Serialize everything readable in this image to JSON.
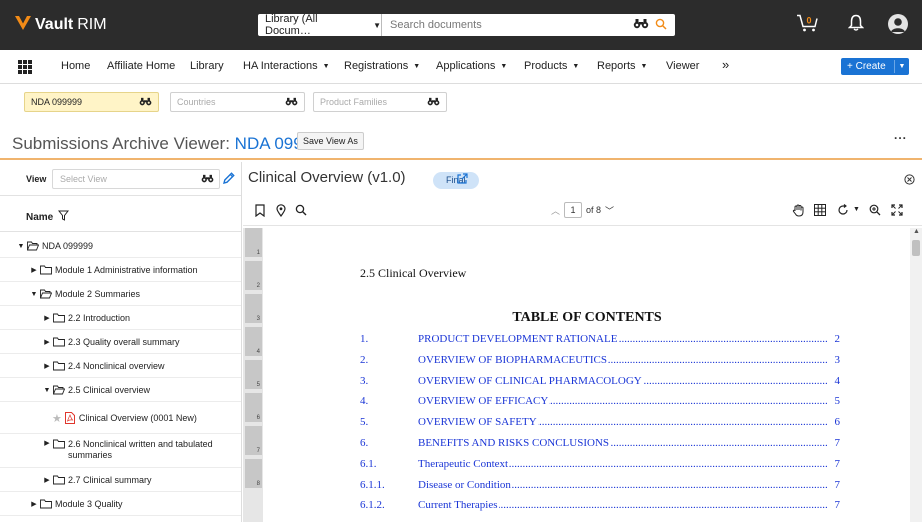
{
  "app": {
    "logo_word": "Vault",
    "logo_suffix": "RIM",
    "brand_color": "#f28b17"
  },
  "search": {
    "scope_label": "Library (All Docum…",
    "placeholder": "Search documents"
  },
  "header_icons": [
    "binoculars-icon",
    "search-icon",
    "cart-icon",
    "bell-icon",
    "avatar"
  ],
  "cart": {
    "count": "0"
  },
  "nav": {
    "items": [
      {
        "label": "Home",
        "dropdown": false
      },
      {
        "label": "Affiliate Home",
        "dropdown": false
      },
      {
        "label": "Library",
        "dropdown": false
      },
      {
        "label": "HA Interactions",
        "dropdown": true
      },
      {
        "label": "Registrations",
        "dropdown": true
      },
      {
        "label": "Applications",
        "dropdown": true
      },
      {
        "label": "Products",
        "dropdown": true
      },
      {
        "label": "Reports",
        "dropdown": true
      },
      {
        "label": "Viewer",
        "dropdown": false
      }
    ],
    "more": "»",
    "create_label": "+ Create"
  },
  "filters": {
    "application": "NDA 099999",
    "countries_placeholder": "Countries",
    "product_families_placeholder": "Product Families"
  },
  "page": {
    "title_prefix": "Submissions Archive Viewer: ",
    "title_link": "NDA 099999",
    "save_view_label": "Save View As",
    "more": "..."
  },
  "left_panel": {
    "view_label": "View",
    "view_placeholder": "Select View",
    "name_header": "Name",
    "tree": [
      {
        "label": "NDA 099999",
        "level": 0,
        "expanded": true,
        "type": "folder"
      },
      {
        "label": "Module 1 Administrative information",
        "level": 1,
        "expanded": false,
        "type": "folder"
      },
      {
        "label": "Module 2 Summaries",
        "level": 1,
        "expanded": true,
        "type": "folder"
      },
      {
        "label": "2.2 Introduction",
        "level": 2,
        "expanded": false,
        "type": "folder"
      },
      {
        "label": "2.3 Quality overall summary",
        "level": 2,
        "expanded": false,
        "type": "folder"
      },
      {
        "label": "2.4 Nonclinical overview",
        "level": 2,
        "expanded": false,
        "type": "folder"
      },
      {
        "label": "2.5 Clinical overview",
        "level": 2,
        "expanded": true,
        "type": "folder"
      },
      {
        "label": "Clinical Overview (0001 New)",
        "level": 3,
        "type": "document"
      },
      {
        "label": "2.6 Nonclinical written and tabulated summaries",
        "level": 2,
        "expanded": false,
        "type": "folder"
      },
      {
        "label": "2.7 Clinical summary",
        "level": 2,
        "expanded": false,
        "type": "folder"
      },
      {
        "label": "Module 3 Quality",
        "level": 1,
        "expanded": false,
        "type": "folder"
      }
    ]
  },
  "viewer": {
    "doc_title": "Clinical Overview (v1.0)",
    "status": "Final",
    "page_current": "1",
    "page_total": "of 8",
    "thumbnails": [
      "1",
      "2",
      "3",
      "4",
      "5",
      "6",
      "7",
      "8"
    ],
    "toolbar_icons": [
      "bookmark-icon",
      "location-pin-icon",
      "search-icon",
      "hand-tool-icon",
      "grid-view-icon",
      "rotate-icon",
      "zoom-in-icon",
      "fullscreen-icon"
    ]
  },
  "document": {
    "heading": "2.5 Clinical Overview",
    "toc_title": "TABLE OF CONTENTS",
    "toc": [
      {
        "num": "1.",
        "text": "PRODUCT DEVELOPMENT RATIONALE",
        "page": "2",
        "caps": true
      },
      {
        "num": "2.",
        "text": "OVERVIEW OF BIOPHARMACEUTICS",
        "page": "3",
        "caps": true
      },
      {
        "num": "3.",
        "text": "OVERVIEW OF CLINICAL PHARMACOLOGY",
        "page": "4",
        "caps": true
      },
      {
        "num": "4.",
        "text": "OVERVIEW OF EFFICACY",
        "page": "5",
        "caps": true
      },
      {
        "num": "5.",
        "text": "OVERVIEW OF SAFETY",
        "page": "6",
        "caps": true
      },
      {
        "num": "6.",
        "text": "BENEFITS AND RISKS CONCLUSIONS",
        "page": "7",
        "caps": true
      },
      {
        "num": "6.1.",
        "text": "Therapeutic Context",
        "page": "7",
        "caps": false
      },
      {
        "num": "6.1.1.",
        "text": "Disease or Condition",
        "page": "7",
        "caps": false
      },
      {
        "num": "6.1.2.",
        "text": "Current Therapies",
        "page": "7",
        "caps": false
      }
    ]
  }
}
